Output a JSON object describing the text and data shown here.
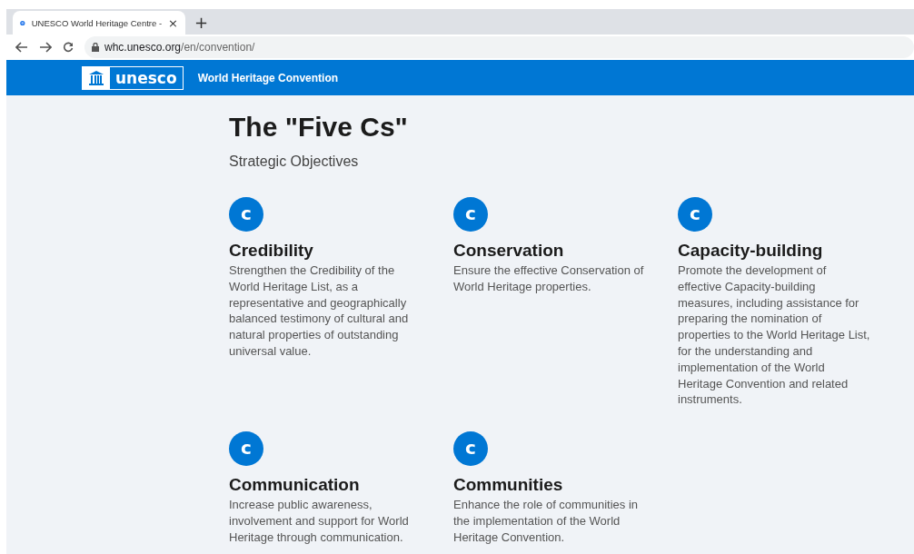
{
  "browser": {
    "tab": {
      "title": "UNESCO World Heritage Centre -",
      "close": "×",
      "selected": true
    },
    "new_tab": "+",
    "url_host": "whc.unesco.org",
    "url_path": "/en/convention/"
  },
  "header": {
    "logo": "unesco",
    "site_title": "World Heritage Convention"
  },
  "page": {
    "title": "The \"Five Cs\"",
    "subtitle": "Strategic Objectives",
    "objectives": [
      {
        "badge": "c",
        "name": "Credibility",
        "text": "Strengthen the Credibility of the World Heritage List, as a representative and geographically balanced testimony of cultural and natural properties of outstanding universal value."
      },
      {
        "badge": "c",
        "name": "Conservation",
        "text": "Ensure the effective Conservation of World Heritage properties."
      },
      {
        "badge": "c",
        "name": "Capacity-building",
        "text": "Promote the development of effective Capacity-building measures, including assistance for preparing the nomination of properties to the World Heritage List, for the understanding and implementation of the World Heritage Convention and related instruments."
      },
      {
        "badge": "c",
        "name": "Communication",
        "text": "Increase public awareness, involvement and support for World Heritage through communication."
      },
      {
        "badge": "c",
        "name": "Communities",
        "text": "Enhance the role of communities in the implementation of the World Heritage Convention."
      }
    ]
  }
}
